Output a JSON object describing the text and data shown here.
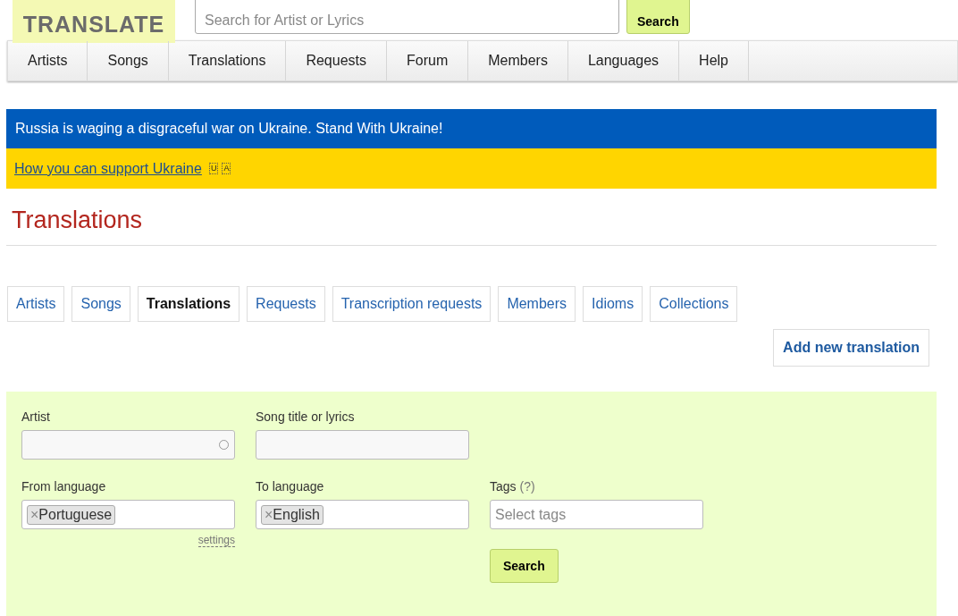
{
  "logo": {
    "text": "TRANSLATE"
  },
  "header_search": {
    "placeholder": "Search for Artist or Lyrics",
    "button": "Search"
  },
  "nav": [
    "Artists",
    "Songs",
    "Translations",
    "Requests",
    "Forum",
    "Members",
    "Languages",
    "Help"
  ],
  "banner": {
    "message": "Russia is waging a disgraceful war on Ukraine. Stand With Ukraine!",
    "link": "How you can support Ukraine",
    "flag_letters": [
      "U",
      "A"
    ]
  },
  "page_title": "Translations",
  "tabs": [
    {
      "label": "Artists",
      "selected": false
    },
    {
      "label": "Songs",
      "selected": false
    },
    {
      "label": "Translations",
      "selected": true
    },
    {
      "label": "Requests",
      "selected": false
    },
    {
      "label": "Transcription requests",
      "selected": false
    },
    {
      "label": "Members",
      "selected": false
    },
    {
      "label": "Idioms",
      "selected": false
    },
    {
      "label": "Collections",
      "selected": false
    }
  ],
  "add_button": "Add new translation",
  "form": {
    "artist_label": "Artist",
    "song_label": "Song title or lyrics",
    "from_label": "From language",
    "from_value": "Portuguese",
    "to_label": "To language",
    "to_value": "English",
    "tags_label": "Tags",
    "tags_hint": "(?)",
    "tags_placeholder": "Select tags",
    "settings_link": "settings",
    "search_button": "Search",
    "remove_mark": "×"
  }
}
